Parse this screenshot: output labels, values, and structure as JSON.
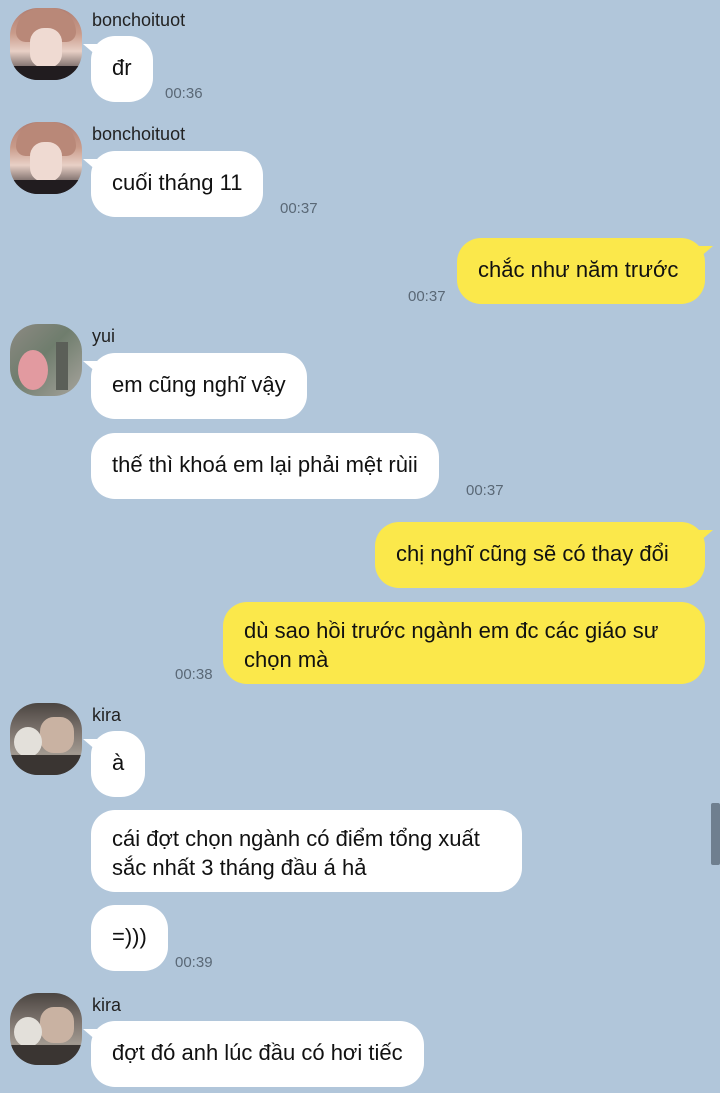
{
  "messages": [
    {
      "sender": "bonchoituot",
      "text": "đr",
      "time": "00:36"
    },
    {
      "sender": "bonchoituot",
      "text": "cuối tháng 11",
      "time": "00:37"
    },
    {
      "sender": "me",
      "text": "chắc như năm trước",
      "time": "00:37"
    },
    {
      "sender": "yui",
      "text": "em cũng nghĩ vậy"
    },
    {
      "sender": "yui",
      "text": "thế thì khoá em lại phải mệt rùii",
      "time": "00:37"
    },
    {
      "sender": "me",
      "text": "chị nghĩ cũng sẽ có thay đổi"
    },
    {
      "sender": "me",
      "lines": [
        "dù sao hồi trước ngành em đc các giáo sư",
        "chọn mà"
      ],
      "time": "00:38"
    },
    {
      "sender": "kira",
      "text": "à"
    },
    {
      "sender": "kira",
      "lines": [
        "cái đợt chọn ngành có điểm tổng xuất",
        "sắc nhất 3 tháng đầu á hả"
      ]
    },
    {
      "sender": "kira",
      "text": "=)))",
      "time": "00:39"
    },
    {
      "sender": "kira",
      "text": "đợt đó anh lúc đầu có hơi tiếc"
    }
  ],
  "avatars": {
    "bonchoituot": "avatar-photo-boy",
    "yui": "avatar-photo-pink-hair",
    "kira": "avatar-photo-cat"
  },
  "colors": {
    "background": "#b1c6da",
    "incoming_bubble": "#ffffff",
    "outgoing_bubble": "#fbe84b"
  }
}
